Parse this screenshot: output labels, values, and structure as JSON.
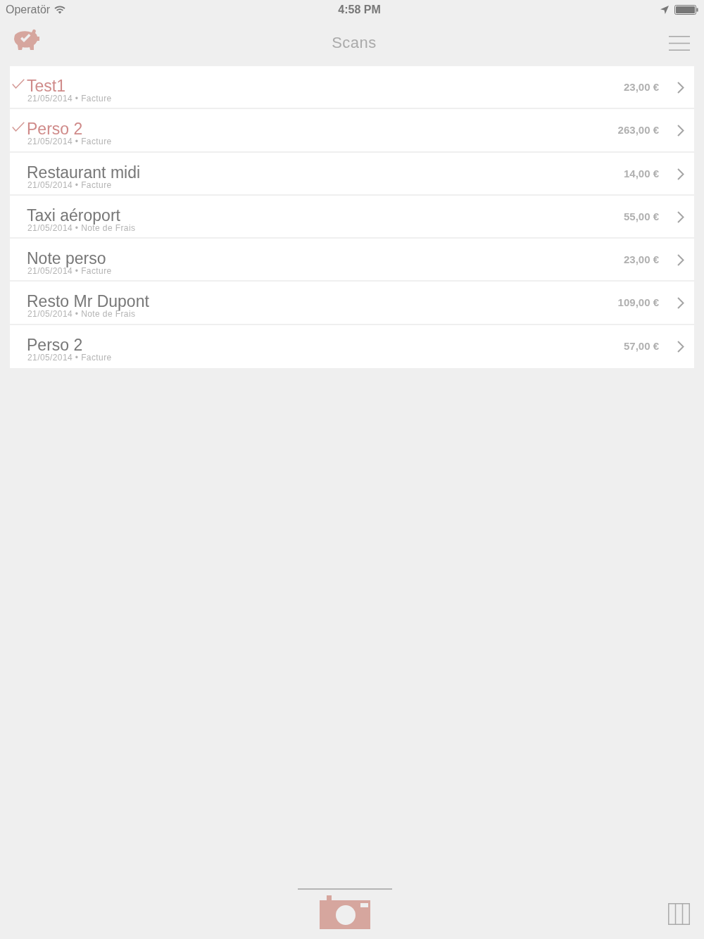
{
  "status_bar": {
    "carrier": "Operatör",
    "time": "4:58 PM"
  },
  "nav_bar": {
    "title": "Scans"
  },
  "scans": [
    {
      "title": "Test1",
      "subtitle": "21/05/2014 • Facture",
      "amount": "23,00 €",
      "checked": true
    },
    {
      "title": "Perso 2",
      "subtitle": "21/05/2014 • Facture",
      "amount": "263,00 €",
      "checked": true
    },
    {
      "title": "Restaurant midi",
      "subtitle": "21/05/2014 • Facture",
      "amount": "14,00 €",
      "checked": false
    },
    {
      "title": "Taxi aéroport",
      "subtitle": "21/05/2014 • Note de Frais",
      "amount": "55,00 €",
      "checked": false
    },
    {
      "title": "Note perso",
      "subtitle": "21/05/2014 • Facture",
      "amount": "23,00 €",
      "checked": false
    },
    {
      "title": "Resto Mr Dupont",
      "subtitle": "21/05/2014 • Note de Frais",
      "amount": "109,00 €",
      "checked": false
    },
    {
      "title": "Perso 2",
      "subtitle": "21/05/2014 • Facture",
      "amount": "57,00 €",
      "checked": false
    }
  ]
}
